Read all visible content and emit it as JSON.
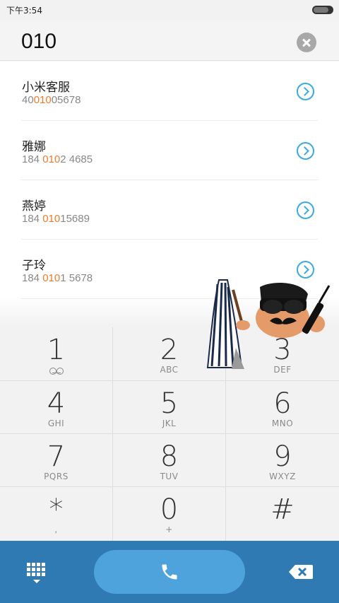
{
  "status_bar": {
    "time": "下午3:54",
    "battery_level": 0.8
  },
  "search": {
    "query": "010"
  },
  "results": [
    {
      "name": "小米客服",
      "number_parts": [
        "40",
        "010",
        "05678"
      ]
    },
    {
      "name": "雅娜",
      "number_parts": [
        "184 ",
        "010",
        "2 4685"
      ]
    },
    {
      "name": "燕婷",
      "number_parts": [
        "184 ",
        "010",
        "15689"
      ]
    },
    {
      "name": "子玲",
      "number_parts": [
        "184 ",
        "010",
        "1 5678"
      ]
    }
  ],
  "keypad": [
    {
      "digit": "1",
      "letters": "",
      "icon": "voicemail-icon"
    },
    {
      "digit": "2",
      "letters": "ABC"
    },
    {
      "digit": "3",
      "letters": "DEF"
    },
    {
      "digit": "4",
      "letters": "GHI"
    },
    {
      "digit": "5",
      "letters": "JKL"
    },
    {
      "digit": "6",
      "letters": "MNO"
    },
    {
      "digit": "7",
      "letters": "PQRS"
    },
    {
      "digit": "8",
      "letters": "TUV"
    },
    {
      "digit": "9",
      "letters": "WXYZ"
    },
    {
      "digit": "*",
      "letters": ","
    },
    {
      "digit": "0",
      "letters": "+"
    },
    {
      "digit": "#",
      "letters": ""
    }
  ],
  "bottom_bar": {
    "keypad_toggle_icon": "dialpad-icon",
    "call_icon": "phone-icon",
    "delete_icon": "backspace-icon"
  },
  "colors": {
    "highlight": "#f07a2b",
    "accent": "#3ba9e4",
    "bottom_bar": "#2f7ab2",
    "call_button": "#4fa3dc"
  }
}
